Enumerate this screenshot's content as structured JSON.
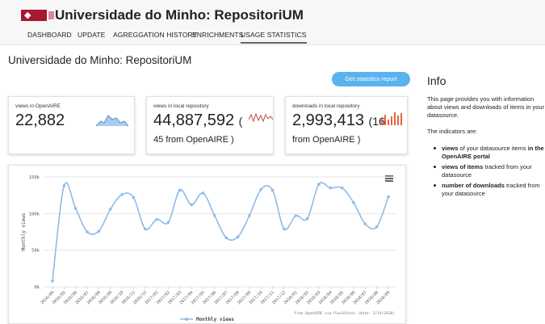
{
  "header": {
    "title": "Universidade do Minho: RepositoriUM",
    "tabs": [
      {
        "label": "DASHBOARD"
      },
      {
        "label": "UPDATE"
      },
      {
        "label": "AGREGGATION HISTORY"
      },
      {
        "label": "ENRICHMENTS"
      },
      {
        "label": "USAGE STATISTICS",
        "active": true
      }
    ]
  },
  "page": {
    "title": "Universidade do Minho: RepositoriUM",
    "report_button": "Get statistics report"
  },
  "cards": [
    {
      "label": "views in OpenAIRE",
      "value": "22,882"
    },
    {
      "label": "views in local repository",
      "value": "44,887,592",
      "suffix": "(",
      "extra": "45 from OpenAIRE )"
    },
    {
      "label": "downloads in local repository",
      "value": "2,993,413",
      "suffix": "(16",
      "extra": "from OpenAIRE )"
    }
  ],
  "info": {
    "heading": "Info",
    "paragraph": "This page provides you with information about views and downloads of items in your datasource.",
    "indicators_intro": "The indicators are:",
    "items": [
      {
        "bold": "views",
        "text": " of your datasource items ",
        "bold2": "in the OpenAIRE portal"
      },
      {
        "bold": "views of items",
        "text": " tracked from your datasource",
        "bold2": ""
      },
      {
        "bold": "number of downloads",
        "text": " tracked from your datasource",
        "bold2": ""
      }
    ]
  },
  "colors": {
    "accent": "#5ab3ee",
    "series": "#8fbbe8",
    "downloads_bars": "#e8653a",
    "brand": "#a6192e"
  },
  "icons": {
    "menu": "hamburger-icon",
    "legend": "legend-marker-icon"
  },
  "chart_data": {
    "type": "line",
    "ylabel": "Monthly views",
    "ylim": [
      0,
      150000
    ],
    "yticks": [
      "150k",
      "100k",
      "50k",
      "0k"
    ],
    "x": [
      "2016/04",
      "2016/05",
      "2016/06",
      "2016/07",
      "2016/08",
      "2016/09",
      "2016/10",
      "2016/11",
      "2016/12",
      "2017/01",
      "2017/02",
      "2017/03",
      "2017/04",
      "2017/05",
      "2017/06",
      "2017/07",
      "2017/08",
      "2017/09",
      "2017/10",
      "2017/11",
      "2017/12",
      "2018/01",
      "2018/02",
      "2018/03",
      "2018/04",
      "2018/05",
      "2018/06",
      "2018/07",
      "2018/08",
      "2018/09"
    ],
    "series": [
      {
        "name": "Monthly views",
        "values": [
          8000,
          138000,
          107000,
          75000,
          76000,
          106000,
          126000,
          122000,
          79000,
          92000,
          88000,
          132000,
          112000,
          128000,
          97000,
          67000,
          68000,
          97000,
          133000,
          132000,
          79000,
          97000,
          93000,
          140000,
          135000,
          135000,
          115000,
          86000,
          82000,
          123000
        ]
      }
    ],
    "source_note": "from OpenAIRE via PiwikStats (date: 2/14/2018)",
    "grid": true,
    "legend": "bottom"
  }
}
